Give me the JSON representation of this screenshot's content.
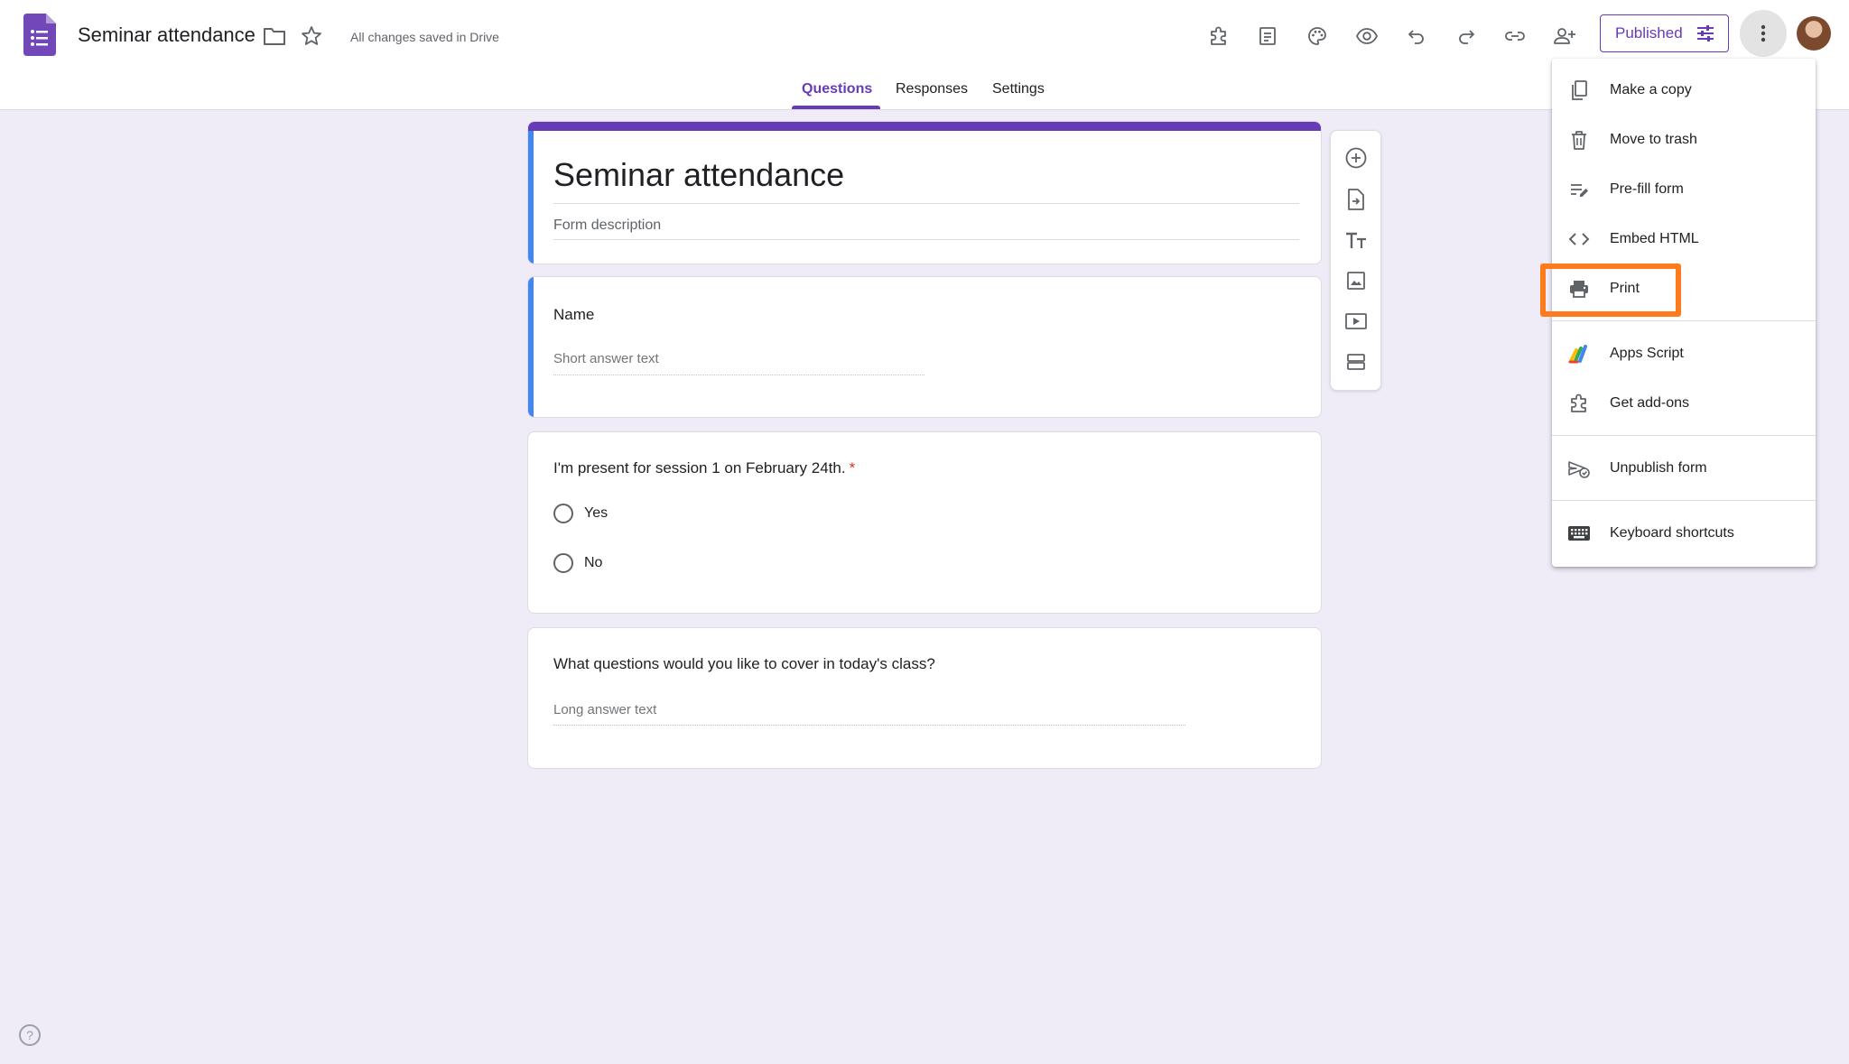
{
  "header": {
    "doc_title": "Seminar attendance",
    "save_status": "All changes saved in Drive",
    "published_label": "Published"
  },
  "tabs": [
    {
      "label": "Questions",
      "active": true
    },
    {
      "label": "Responses",
      "active": false
    },
    {
      "label": "Settings",
      "active": false
    }
  ],
  "form": {
    "title": "Seminar attendance",
    "description_placeholder": "Form description"
  },
  "questions": [
    {
      "label": "Name",
      "type": "short",
      "placeholder": "Short answer text"
    },
    {
      "label": "I'm present for session 1 on February 24th.",
      "required_mark": "*",
      "type": "radio",
      "options": [
        "Yes",
        "No"
      ]
    },
    {
      "label": "What questions would you like to cover in today's class?",
      "type": "long",
      "placeholder": "Long answer text"
    }
  ],
  "menu": {
    "items": [
      {
        "label": "Make a copy",
        "icon": "copy-icon"
      },
      {
        "label": "Move to trash",
        "icon": "trash-icon"
      },
      {
        "label": "Pre-fill form",
        "icon": "prefill-icon"
      },
      {
        "label": "Embed HTML",
        "icon": "code-icon"
      },
      {
        "label": "Print",
        "icon": "print-icon",
        "highlighted": true
      },
      {
        "label": "Apps Script",
        "icon": "apps-script-icon"
      },
      {
        "label": "Get add-ons",
        "icon": "puzzle-icon"
      },
      {
        "label": "Unpublish form",
        "icon": "unpublish-icon"
      },
      {
        "label": "Keyboard shortcuts",
        "icon": "keyboard-icon"
      }
    ]
  },
  "colors": {
    "accent": "#673ab7",
    "active_strip": "#4285f4",
    "highlight": "#ff7a1a",
    "background": "#efebf7",
    "required": "#d93025"
  },
  "help_label": "?"
}
